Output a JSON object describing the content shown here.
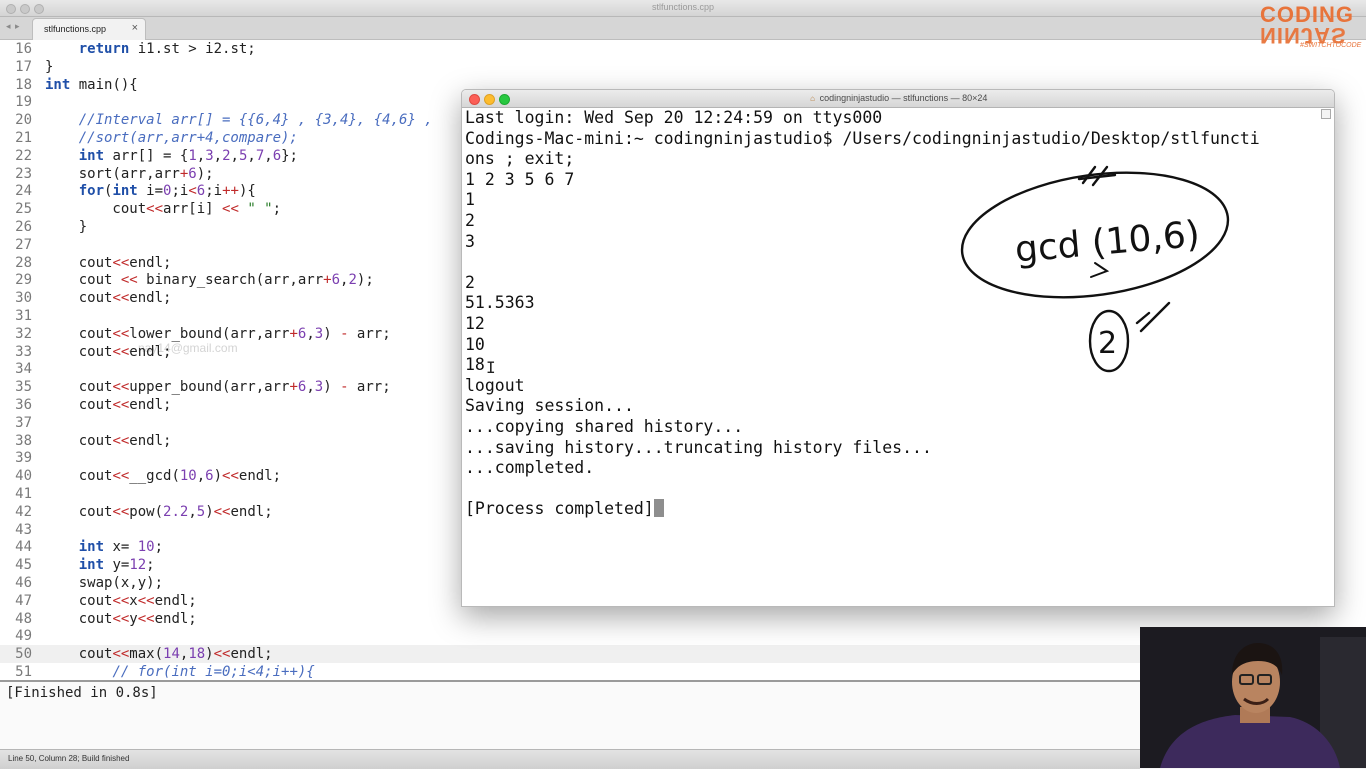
{
  "window": {
    "title": "stlfunctions.cpp"
  },
  "tabbar": {
    "nav_arrows": "◂ ▸",
    "tab_label": "stlfunctions.cpp",
    "tab_close": "×"
  },
  "editor": {
    "current_line": 50,
    "watermark": "...nay14@gmail.com",
    "lines": [
      {
        "n": "16",
        "text": "    return i1.st > i2.st;"
      },
      {
        "n": "17",
        "text": "}"
      },
      {
        "n": "18",
        "text": "int main(){"
      },
      {
        "n": "19",
        "text": ""
      },
      {
        "n": "20",
        "text": "    //Interval arr[] = {{6,4} , {3,4}, {4,6} ,"
      },
      {
        "n": "21",
        "text": "    //sort(arr,arr+4,compare);"
      },
      {
        "n": "22",
        "text": "    int arr[] = {1,3,2,5,7,6};"
      },
      {
        "n": "23",
        "text": "    sort(arr,arr+6);"
      },
      {
        "n": "24",
        "text": "    for(int i=0;i<6;i++){"
      },
      {
        "n": "25",
        "text": "        cout<<arr[i] << \" \";"
      },
      {
        "n": "26",
        "text": "    }"
      },
      {
        "n": "27",
        "text": ""
      },
      {
        "n": "28",
        "text": "    cout<<endl;"
      },
      {
        "n": "29",
        "text": "    cout << binary_search(arr,arr+6,2);"
      },
      {
        "n": "30",
        "text": "    cout<<endl;"
      },
      {
        "n": "31",
        "text": ""
      },
      {
        "n": "32",
        "text": "    cout<<lower_bound(arr,arr+6,3) - arr;"
      },
      {
        "n": "33",
        "text": "    cout<<endl;"
      },
      {
        "n": "34",
        "text": ""
      },
      {
        "n": "35",
        "text": "    cout<<upper_bound(arr,arr+6,3) - arr;"
      },
      {
        "n": "36",
        "text": "    cout<<endl;"
      },
      {
        "n": "37",
        "text": ""
      },
      {
        "n": "38",
        "text": "    cout<<endl;"
      },
      {
        "n": "39",
        "text": ""
      },
      {
        "n": "40",
        "text": "    cout<<__gcd(10,6)<<endl;"
      },
      {
        "n": "41",
        "text": ""
      },
      {
        "n": "42",
        "text": "    cout<<pow(2.2,5)<<endl;"
      },
      {
        "n": "43",
        "text": ""
      },
      {
        "n": "44",
        "text": "    int x= 10;"
      },
      {
        "n": "45",
        "text": "    int y=12;"
      },
      {
        "n": "46",
        "text": "    swap(x,y);"
      },
      {
        "n": "47",
        "text": "    cout<<x<<endl;"
      },
      {
        "n": "48",
        "text": "    cout<<y<<endl;"
      },
      {
        "n": "49",
        "text": ""
      },
      {
        "n": "50",
        "text": "    cout<<max(14,18)<<endl;"
      },
      {
        "n": "51",
        "text": "        // for(int i=0;i<4;i++){"
      }
    ]
  },
  "output_panel": {
    "text": "[Finished in 0.8s]"
  },
  "statusbar": {
    "text": "Line 50, Column 28; Build finished"
  },
  "logo": {
    "top": "CODING",
    "bottom": "NINJAS",
    "tagline": "#SWITCHTOCODE"
  },
  "terminal": {
    "title": "codingninjastudio — stlfunctions — 80×24",
    "lines": [
      "Last login: Wed Sep 20 12:24:59 on ttys000",
      "Codings-Mac-mini:~ codingninjastudio$ /Users/codingninjastudio/Desktop/stlfuncti",
      "ons ; exit;",
      "1 2 3 5 6 7",
      "1",
      "2",
      "3",
      "",
      "2",
      "51.5363",
      "12",
      "10",
      "18",
      "logout",
      "Saving session...",
      "...copying shared history...",
      "...saving history...truncating history files...",
      "...completed.",
      "",
      "[Process completed]"
    ]
  },
  "annotation": {
    "main": "gcd (10,6)",
    "answer": "2"
  },
  "colors": {
    "keyword": "#1f4fa8",
    "number": "#7b3fb0",
    "string": "#2a7d2a",
    "comment": "#4a6dbf",
    "operator": "#c02a2a",
    "brand": "#e8743b",
    "traffic_red": "#fc5f57",
    "traffic_yellow": "#fdbc2e",
    "traffic_green": "#28c840"
  }
}
